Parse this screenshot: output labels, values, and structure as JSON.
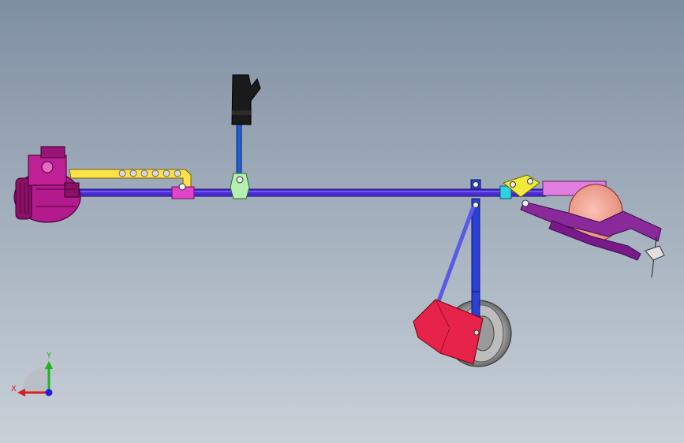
{
  "viewport": {
    "background_top": "#7f8fa3",
    "background_bottom": "#c9d1d8"
  },
  "triad": {
    "x_label": "X",
    "y_label": "Y",
    "x_color": "#d42020",
    "y_color": "#1fb31f",
    "z_color": "#2020d4"
  },
  "model": {
    "shaft_color": "#4a2bd1",
    "engine_color": "#b31a8c",
    "support_bar_color": "#ffe24a",
    "handle_grip_color": "#1a1a1a",
    "handle_stem_color": "#1f5fd6",
    "clamp_color": "#b6f0b0",
    "coupler_color": "#e045c8",
    "wheel_color": "#9a9a9a",
    "counterweight_color": "#e8234a",
    "cutter_disc_color": "#f4a090",
    "cutter_arm_color": "#8a2a9a"
  }
}
